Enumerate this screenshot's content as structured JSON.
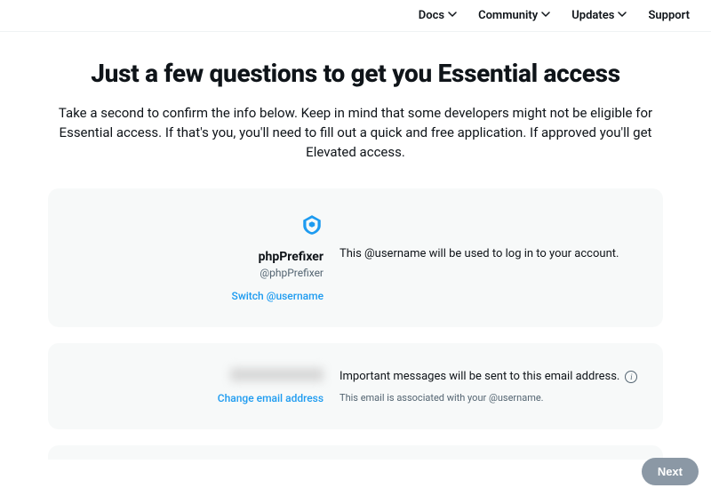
{
  "nav": {
    "docs": "Docs",
    "community": "Community",
    "updates": "Updates",
    "support": "Support"
  },
  "heading": {
    "title": "Just a few questions to get you Essential access",
    "subtitle": "Take a second to confirm the info below. Keep in mind that some developers might not be eligible for Essential access. If that's you, you'll need to fill out a quick and free application. If approved you'll get Elevated access."
  },
  "user_card": {
    "display_name": "phpPrefixer",
    "handle": "@phpPrefixer",
    "switch_link": "Switch @username",
    "description": "This @username will be used to log in to your account."
  },
  "email_card": {
    "change_link": "Change email address",
    "description": "Important messages will be sent to this email address.",
    "subdescription": "This email is associated with your @username."
  },
  "footer": {
    "next": "Next"
  }
}
